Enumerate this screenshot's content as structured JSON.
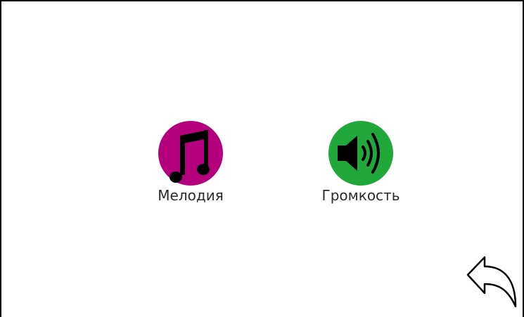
{
  "menu": {
    "items": [
      {
        "label": "Мелодия",
        "icon": "music-note-icon",
        "color": "#b5007e"
      },
      {
        "label": "Громкость",
        "icon": "speaker-volume-icon",
        "color": "#20a83a"
      }
    ]
  },
  "navigation": {
    "back_icon": "back-arrow-icon"
  }
}
